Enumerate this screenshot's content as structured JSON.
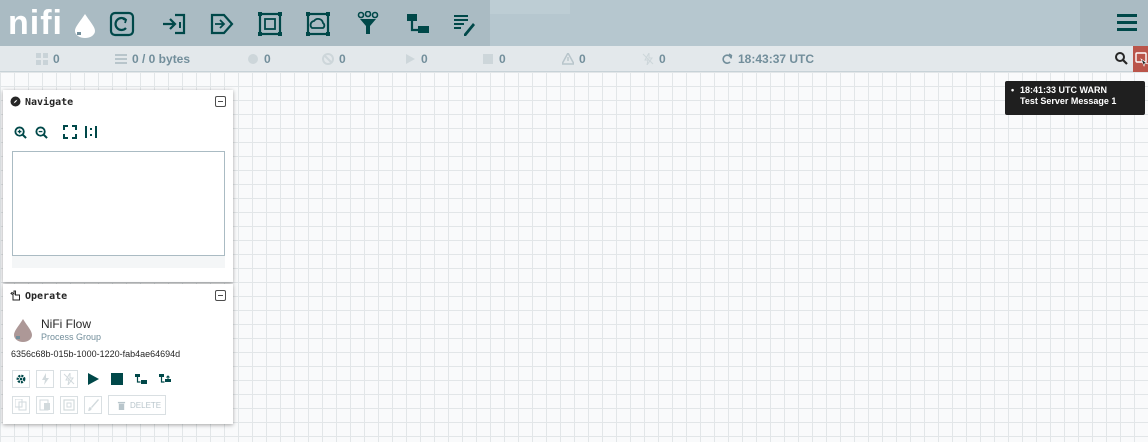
{
  "header": {
    "logo_text": "nifi",
    "toolbar_icons": [
      "processor-icon",
      "input-port-icon",
      "output-port-icon",
      "process-group-icon",
      "remote-process-group-icon",
      "funnel-icon",
      "template-icon",
      "label-icon"
    ],
    "colors": {
      "header_bg": "#aabbc3",
      "icon": "#004849",
      "bulletin_alert": "#ba554a"
    }
  },
  "status": {
    "transmitting": "0",
    "queued": "0 / 0 bytes",
    "in_sync": "0",
    "not_transmitting": "0",
    "running": "0",
    "stopped": "0",
    "invalid": "0",
    "disabled": "0",
    "last_refreshed": "18:43:37 UTC"
  },
  "bulletin_tooltip": {
    "line1": "18:41:33 UTC  WARN",
    "line2": "Test Server Message 1"
  },
  "navigate": {
    "title": "Navigate"
  },
  "operate": {
    "title": "Operate",
    "component_name": "NiFi Flow",
    "component_type": "Process Group",
    "component_id": "6356c68b-015b-1000-1220-fab4ae64694d",
    "delete_label": "DELETE"
  }
}
